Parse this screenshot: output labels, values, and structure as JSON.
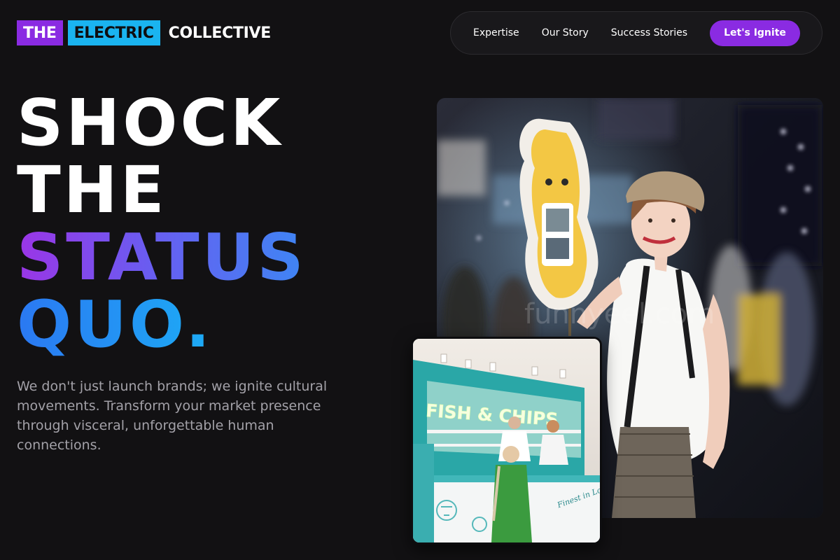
{
  "brand": {
    "word1": "THE",
    "word2": "ELECTRIC",
    "word3": "COLLECTIVE",
    "color_primary": "#8a2be2",
    "color_secondary": "#1ab4f0"
  },
  "nav": {
    "links": [
      "Expertise",
      "Our Story",
      "Success Stories"
    ],
    "cta": "Let's Ignite"
  },
  "hero": {
    "headline": [
      "SHOCK",
      "THE",
      "STATUS",
      "QUO."
    ],
    "tagline": "We don't just launch brands; we ignite cultural movements. Transform your market presence through visceral, unforgettable human connections."
  },
  "images": {
    "main": {
      "subject": "brand-ambassador-at-expo-photo",
      "watermark": "funnyeel.com"
    },
    "secondary": {
      "subject": "fish-and-chips-popup-stall-photo",
      "sign_text": "FISH & CHIPS",
      "counter_text": "Finest in London"
    }
  }
}
